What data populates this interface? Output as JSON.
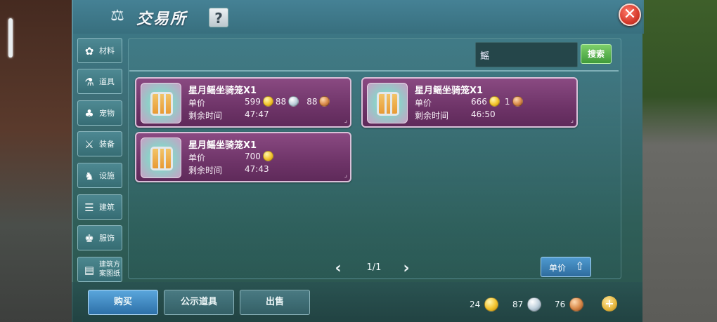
{
  "title": "交易所",
  "help_label": "?",
  "close_label": "✕",
  "sidebar": {
    "items": [
      {
        "label": "材料",
        "icon": "materials-icon",
        "glyph": "✿"
      },
      {
        "label": "道具",
        "icon": "flask-icon",
        "glyph": "⚗"
      },
      {
        "label": "宠物",
        "icon": "paw-icon",
        "glyph": "♣"
      },
      {
        "label": "装备",
        "icon": "sword-icon",
        "glyph": "⚔"
      },
      {
        "label": "设施",
        "icon": "facility-icon",
        "glyph": "♞"
      },
      {
        "label": "建筑",
        "icon": "building-icon",
        "glyph": "☰"
      },
      {
        "label": "服饰",
        "icon": "clothing-icon",
        "glyph": "♚"
      },
      {
        "label": "建筑方案图纸",
        "icon": "blueprint-icon",
        "glyph": "▤"
      }
    ]
  },
  "search": {
    "value": "鳐",
    "button_label": "搜索"
  },
  "listings": [
    {
      "name": "星月鳐坐骑笼X1",
      "price_label": "单价",
      "time_label": "剩余时间",
      "time": "47:47",
      "prices": [
        {
          "amount": "599",
          "coin": "gold"
        },
        {
          "amount": "88",
          "coin": "silver"
        },
        {
          "amount": "88",
          "coin": "bronze"
        }
      ]
    },
    {
      "name": "星月鳐坐骑笼X1",
      "price_label": "单价",
      "time_label": "剩余时间",
      "time": "46:50",
      "prices": [
        {
          "amount": "666",
          "coin": "gold"
        },
        {
          "amount": "1",
          "coin": "bronze"
        }
      ]
    },
    {
      "name": "星月鳐坐骑笼X1",
      "price_label": "单价",
      "time_label": "剩余时间",
      "time": "47:43",
      "prices": [
        {
          "amount": "700",
          "coin": "gold"
        }
      ]
    }
  ],
  "pagination": {
    "prev": "‹",
    "next": "›",
    "page": "1/1"
  },
  "sort": {
    "label": "单价",
    "arrow": "⇧"
  },
  "bottom_tabs": [
    "购买",
    "公示道具",
    "出售"
  ],
  "wallet": [
    {
      "amount": "24",
      "coin": "gold"
    },
    {
      "amount": "87",
      "coin": "silver"
    },
    {
      "amount": "76",
      "coin": "bronze"
    }
  ],
  "add_currency_label": "+"
}
